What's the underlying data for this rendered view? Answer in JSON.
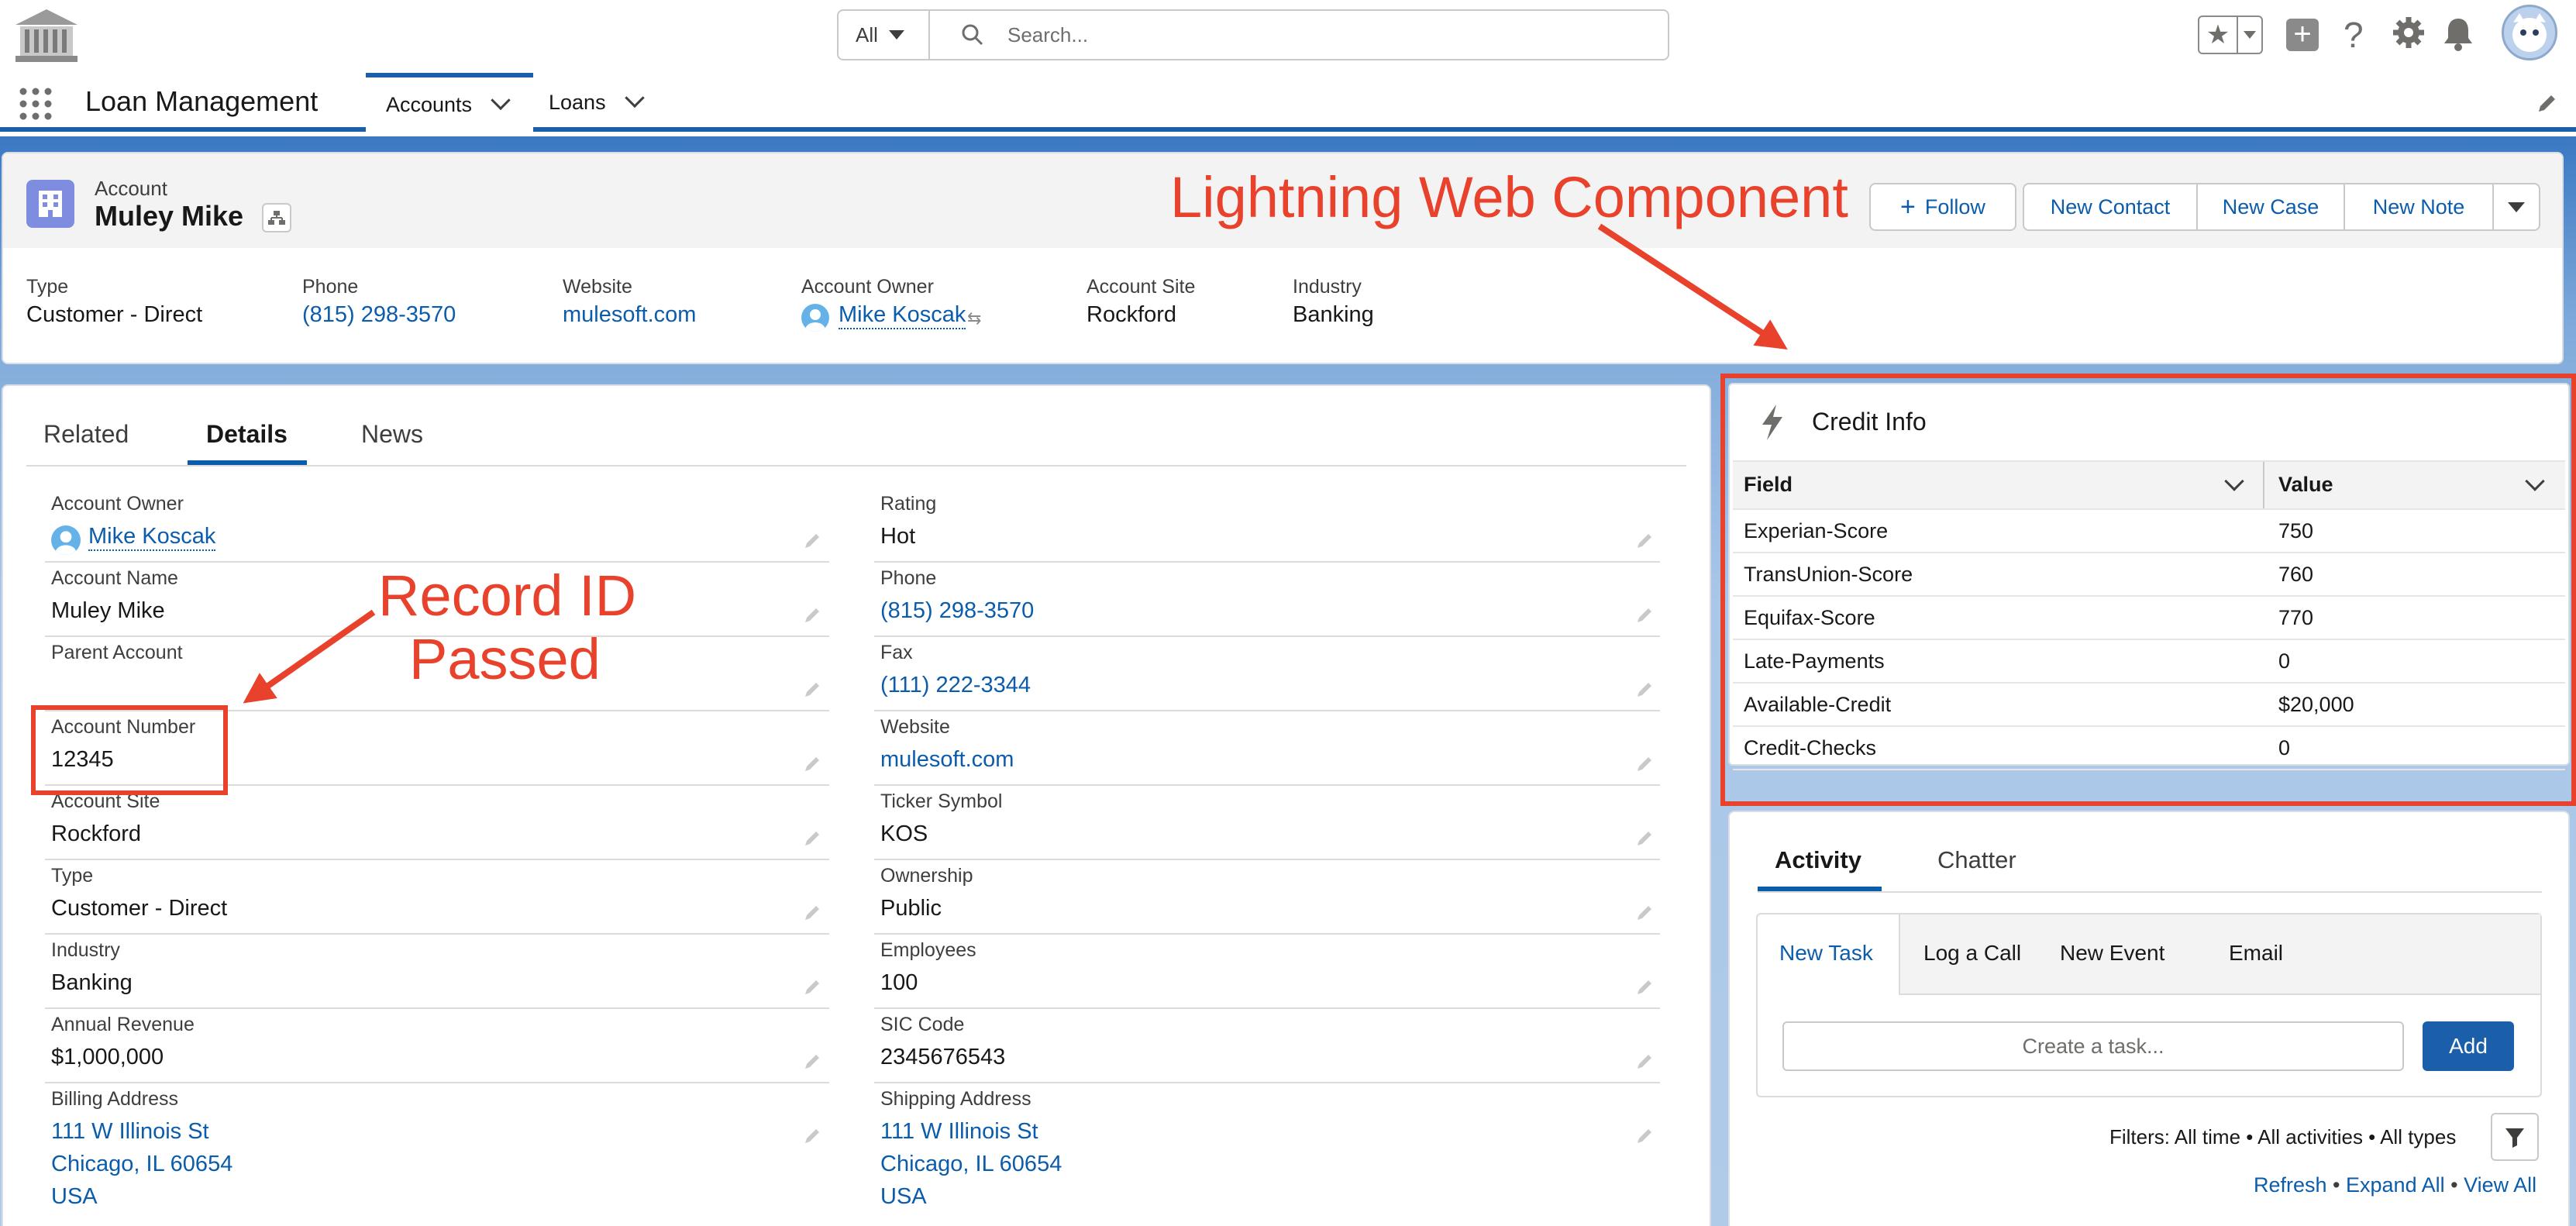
{
  "global": {
    "search_scope": "All",
    "search_placeholder": "Search...",
    "app_name": "Loan Management",
    "nav_tabs": [
      "Accounts",
      "Loans"
    ]
  },
  "highlights": {
    "object_label": "Account",
    "record_name": "Muley Mike",
    "actions": [
      "Follow",
      "New Contact",
      "New Case",
      "New Note"
    ],
    "fields": [
      {
        "label": "Type",
        "value": "Customer - Direct"
      },
      {
        "label": "Phone",
        "value": "(815) 298-3570"
      },
      {
        "label": "Website",
        "value": "mulesoft.com"
      },
      {
        "label": "Account Owner",
        "value": "Mike Koscak"
      },
      {
        "label": "Account Site",
        "value": "Rockford"
      },
      {
        "label": "Industry",
        "value": "Banking"
      }
    ]
  },
  "detail_tabs": [
    "Related",
    "Details",
    "News"
  ],
  "details": {
    "left": [
      {
        "label": "Account Owner",
        "value": "Mike Koscak"
      },
      {
        "label": "Account Name",
        "value": "Muley Mike"
      },
      {
        "label": "Parent Account",
        "value": ""
      },
      {
        "label": "Account Number",
        "value": "12345"
      },
      {
        "label": "Account Site",
        "value": "Rockford"
      },
      {
        "label": "Type",
        "value": "Customer - Direct"
      },
      {
        "label": "Industry",
        "value": "Banking"
      },
      {
        "label": "Annual Revenue",
        "value": "$1,000,000"
      },
      {
        "label": "Billing Address",
        "value": "111 W Illinois St",
        "line2": "Chicago, IL 60654",
        "line3": "USA"
      }
    ],
    "right": [
      {
        "label": "Rating",
        "value": "Hot"
      },
      {
        "label": "Phone",
        "value": "(815) 298-3570"
      },
      {
        "label": "Fax",
        "value": "(111) 222-3344"
      },
      {
        "label": "Website",
        "value": "mulesoft.com"
      },
      {
        "label": "Ticker Symbol",
        "value": "KOS"
      },
      {
        "label": "Ownership",
        "value": "Public"
      },
      {
        "label": "Employees",
        "value": "100"
      },
      {
        "label": "SIC Code",
        "value": "2345676543"
      },
      {
        "label": "Shipping Address",
        "value": "111 W Illinois St",
        "line2": "Chicago, IL 60654",
        "line3": "USA"
      }
    ]
  },
  "credit_info": {
    "title": "Credit Info",
    "columns": [
      "Field",
      "Value"
    ],
    "rows": [
      [
        "Experian-Score",
        "750"
      ],
      [
        "TransUnion-Score",
        "760"
      ],
      [
        "Equifax-Score",
        "770"
      ],
      [
        "Late-Payments",
        "0"
      ],
      [
        "Available-Credit",
        "$20,000"
      ],
      [
        "Credit-Checks",
        "0"
      ]
    ]
  },
  "activity": {
    "tabs": [
      "Activity",
      "Chatter"
    ],
    "subtabs": [
      "New Task",
      "Log a Call",
      "New Event",
      "Email"
    ],
    "task_placeholder": "Create a task...",
    "add_label": "Add",
    "filters_text": "Filters: All time • All activities • All types",
    "links": [
      "Refresh",
      "Expand All",
      "View All"
    ]
  },
  "annotations": {
    "lwc": "Lightning Web Component",
    "record_id_line1": "Record ID",
    "record_id_line2": "Passed"
  },
  "colors": {
    "link": "#0b5cab",
    "brand": "#1b5fab",
    "annotation": "#e8412c",
    "account_icon": "#7f8de1"
  }
}
